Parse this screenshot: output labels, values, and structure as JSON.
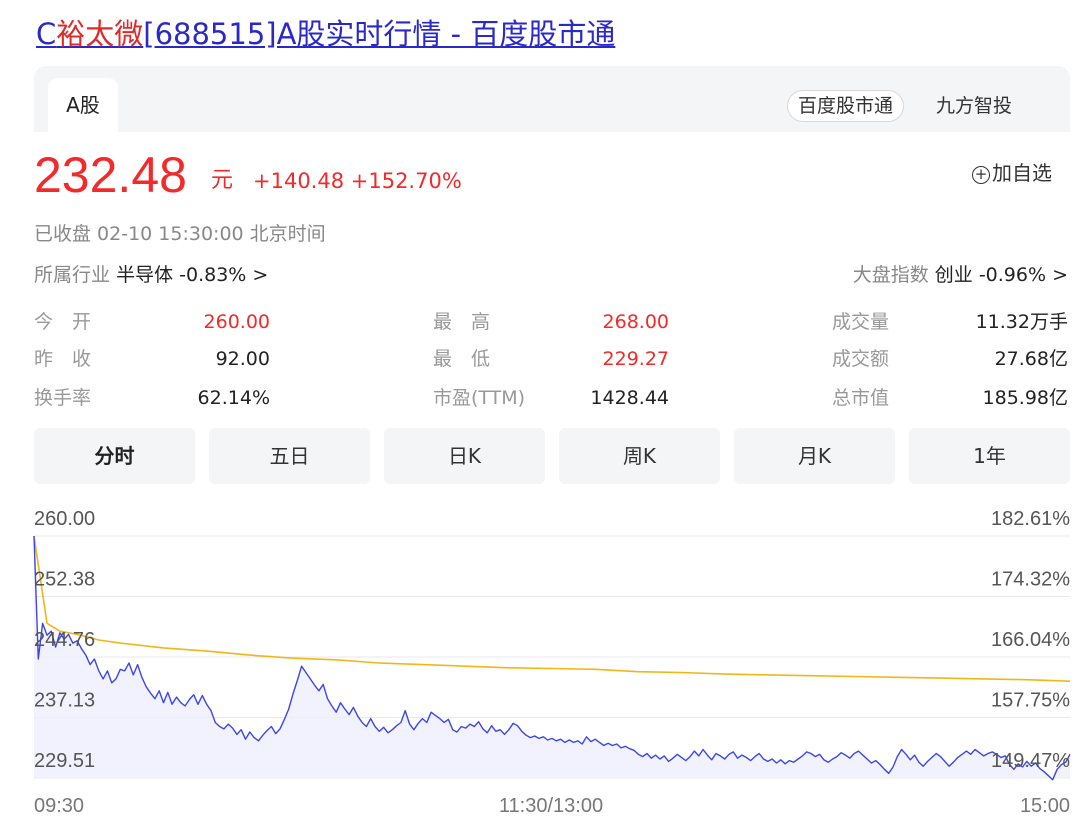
{
  "page_title": {
    "prefix": "C",
    "highlight": "裕太微",
    "suffix": "[688515]A股实时行情 - 百度股市通"
  },
  "tabs_top": {
    "a_share": "A股",
    "source_badge": "百度股市通",
    "partner": "九方智投"
  },
  "quote": {
    "price": "232.48",
    "unit": "元",
    "change": "+140.48 +152.70%",
    "watch_icon": "plus-circle-icon",
    "watch_label": "加自选",
    "status": "已收盘  02-10 15:30:00  北京时间"
  },
  "industry": {
    "label": "所属行业",
    "name": "半导体",
    "change": "-0.83%",
    "chevron": ">"
  },
  "market_index": {
    "label": "大盘指数",
    "name": "创业",
    "change": "-0.96%",
    "chevron": ">"
  },
  "stats": [
    {
      "label": "今　开",
      "value": "260.00",
      "color": "#f22a2a"
    },
    {
      "label": "最　高",
      "value": "268.00",
      "color": "#f22a2a"
    },
    {
      "label": "成交量",
      "value": "11.32万手",
      "color": "#222222"
    },
    {
      "label": "昨　收",
      "value": "92.00",
      "color": "#222222"
    },
    {
      "label": "最　低",
      "value": "229.27",
      "color": "#f22a2a"
    },
    {
      "label": "成交额",
      "value": "27.68亿",
      "color": "#222222"
    },
    {
      "label": "换手率",
      "value": "62.14%",
      "color": "#222222"
    },
    {
      "label": "市盈(TTM)",
      "value": "1428.44",
      "color": "#222222"
    },
    {
      "label": "总市值",
      "value": "185.98亿",
      "color": "#222222"
    }
  ],
  "period_tabs": [
    "分时",
    "五日",
    "日K",
    "周K",
    "月K",
    "1年"
  ],
  "active_period": "分时",
  "colors": {
    "up": "#f22a2a",
    "price_line": "#3d47e6",
    "avg_line": "#f2b619",
    "area_fill": "#eceefc",
    "link": "#2a28c9"
  },
  "chart_data": {
    "type": "line",
    "y_left_ticks": [
      "260.00",
      "252.38",
      "244.76",
      "237.13",
      "229.51"
    ],
    "y_right_ticks": [
      "182.61%",
      "174.32%",
      "166.04%",
      "157.75%",
      "149.47%"
    ],
    "x_ticks": [
      "09:30",
      "11:30/13:00",
      "15:00"
    ],
    "ylim": [
      229.51,
      260.0
    ],
    "x_range_minutes": [
      0,
      240
    ],
    "grid": true,
    "series": [
      {
        "values": [
          [
            0,
            260.0
          ],
          [
            1,
            244.5
          ],
          [
            2,
            249.0
          ],
          [
            3,
            247.5
          ],
          [
            4,
            248.0
          ],
          [
            5,
            246.0
          ],
          [
            6,
            247.8
          ],
          [
            7,
            247.0
          ],
          [
            8,
            247.6
          ],
          [
            9,
            246.5
          ],
          [
            10,
            246.8
          ],
          [
            11,
            245.8
          ],
          [
            12,
            245.0
          ],
          [
            13,
            243.8
          ],
          [
            14,
            244.5
          ],
          [
            15,
            243.0
          ],
          [
            16,
            242.0
          ],
          [
            17,
            243.0
          ],
          [
            18,
            241.5
          ],
          [
            19,
            242.0
          ],
          [
            20,
            243.2
          ],
          [
            21,
            243.0
          ],
          [
            22,
            244.0
          ],
          [
            23,
            242.5
          ],
          [
            24,
            243.8
          ],
          [
            25,
            242.2
          ],
          [
            26,
            241.0
          ],
          [
            27,
            240.2
          ],
          [
            28,
            239.5
          ],
          [
            29,
            240.5
          ],
          [
            30,
            239.0
          ],
          [
            31,
            240.3
          ],
          [
            32,
            238.8
          ],
          [
            33,
            239.7
          ],
          [
            34,
            239.0
          ],
          [
            35,
            238.6
          ],
          [
            36,
            239.4
          ],
          [
            37,
            240.0
          ],
          [
            38,
            238.8
          ],
          [
            39,
            239.9
          ],
          [
            40,
            238.8
          ],
          [
            41,
            238.0
          ],
          [
            42,
            236.5
          ],
          [
            43,
            236.0
          ],
          [
            44,
            235.7
          ],
          [
            45,
            236.3
          ],
          [
            46,
            235.8
          ],
          [
            47,
            235.0
          ],
          [
            48,
            235.6
          ],
          [
            49,
            234.4
          ],
          [
            50,
            235.3
          ],
          [
            51,
            234.6
          ],
          [
            52,
            234.2
          ],
          [
            53,
            234.9
          ],
          [
            54,
            235.5
          ],
          [
            55,
            236.0
          ],
          [
            56,
            235.1
          ],
          [
            57,
            235.7
          ],
          [
            58,
            236.9
          ],
          [
            59,
            238.2
          ],
          [
            60,
            240.1
          ],
          [
            61,
            241.8
          ],
          [
            62,
            243.6
          ],
          [
            63,
            242.8
          ],
          [
            64,
            242.0
          ],
          [
            65,
            241.2
          ],
          [
            66,
            240.5
          ],
          [
            67,
            241.3
          ],
          [
            68,
            239.5
          ],
          [
            69,
            238.6
          ],
          [
            70,
            237.8
          ],
          [
            71,
            239.0
          ],
          [
            72,
            238.2
          ],
          [
            73,
            237.5
          ],
          [
            74,
            238.4
          ],
          [
            75,
            237.3
          ],
          [
            76,
            236.5
          ],
          [
            77,
            236.0
          ],
          [
            78,
            237.0
          ],
          [
            79,
            236.0
          ],
          [
            80,
            235.4
          ],
          [
            81,
            235.9
          ],
          [
            82,
            235.2
          ],
          [
            83,
            235.6
          ],
          [
            84,
            236.1
          ],
          [
            85,
            236.5
          ],
          [
            86,
            238.0
          ],
          [
            87,
            236.3
          ],
          [
            88,
            235.6
          ],
          [
            89,
            236.4
          ],
          [
            90,
            237.0
          ],
          [
            91,
            236.5
          ],
          [
            92,
            237.8
          ],
          [
            93,
            237.4
          ],
          [
            94,
            237.0
          ],
          [
            95,
            236.5
          ],
          [
            96,
            236.9
          ],
          [
            97,
            235.6
          ],
          [
            98,
            235.3
          ],
          [
            99,
            236.0
          ],
          [
            100,
            235.8
          ],
          [
            101,
            236.3
          ],
          [
            102,
            236.0
          ],
          [
            103,
            236.6
          ],
          [
            104,
            235.7
          ],
          [
            105,
            235.2
          ],
          [
            106,
            236.1
          ],
          [
            107,
            235.4
          ],
          [
            108,
            235.6
          ],
          [
            109,
            235.0
          ],
          [
            110,
            235.6
          ],
          [
            111,
            236.4
          ],
          [
            112,
            236.1
          ],
          [
            113,
            235.4
          ],
          [
            114,
            234.9
          ],
          [
            115,
            234.6
          ],
          [
            116,
            234.8
          ],
          [
            117,
            234.5
          ],
          [
            118,
            234.7
          ],
          [
            119,
            234.3
          ],
          [
            120,
            234.5
          ],
          [
            121,
            234.2
          ],
          [
            122,
            234.4
          ],
          [
            123,
            234.0
          ],
          [
            124,
            234.3
          ],
          [
            125,
            234.0
          ],
          [
            126,
            234.2
          ],
          [
            127,
            233.8
          ],
          [
            128,
            234.7
          ],
          [
            129,
            234.1
          ],
          [
            130,
            234.4
          ],
          [
            131,
            234.0
          ],
          [
            132,
            233.6
          ],
          [
            133,
            233.9
          ],
          [
            134,
            233.6
          ],
          [
            135,
            233.8
          ],
          [
            136,
            233.3
          ],
          [
            137,
            233.5
          ],
          [
            138,
            233.2
          ],
          [
            139,
            233.0
          ],
          [
            140,
            232.5
          ],
          [
            141,
            232.2
          ],
          [
            142,
            232.6
          ],
          [
            143,
            232.0
          ],
          [
            144,
            232.4
          ],
          [
            145,
            231.9
          ],
          [
            146,
            232.3
          ],
          [
            147,
            231.6
          ],
          [
            148,
            232.0
          ],
          [
            149,
            232.5
          ],
          [
            150,
            232.1
          ],
          [
            151,
            231.7
          ],
          [
            152,
            232.2
          ],
          [
            153,
            232.9
          ],
          [
            154,
            232.3
          ],
          [
            155,
            233.1
          ],
          [
            156,
            232.4
          ],
          [
            157,
            231.8
          ],
          [
            158,
            232.6
          ],
          [
            159,
            232.3
          ],
          [
            160,
            231.9
          ],
          [
            161,
            232.5
          ],
          [
            162,
            232.8
          ],
          [
            163,
            232.0
          ],
          [
            164,
            232.4
          ],
          [
            165,
            232.1
          ],
          [
            166,
            231.7
          ],
          [
            167,
            232.2
          ],
          [
            168,
            232.6
          ],
          [
            169,
            231.9
          ],
          [
            170,
            231.6
          ],
          [
            171,
            231.9
          ],
          [
            172,
            231.4
          ],
          [
            173,
            231.8
          ],
          [
            174,
            231.3
          ],
          [
            175,
            231.7
          ],
          [
            176,
            231.5
          ],
          [
            177,
            231.9
          ],
          [
            178,
            232.3
          ],
          [
            179,
            232.8
          ],
          [
            180,
            232.6
          ],
          [
            181,
            232.2
          ],
          [
            182,
            232.5
          ],
          [
            183,
            231.8
          ],
          [
            184,
            231.5
          ],
          [
            185,
            231.9
          ],
          [
            186,
            232.2
          ],
          [
            187,
            232.7
          ],
          [
            188,
            232.4
          ],
          [
            189,
            232.0
          ],
          [
            190,
            232.6
          ],
          [
            191,
            232.9
          ],
          [
            192,
            232.4
          ],
          [
            193,
            231.9
          ],
          [
            194,
            231.4
          ],
          [
            195,
            231.7
          ],
          [
            196,
            231.2
          ],
          [
            197,
            230.6
          ],
          [
            198,
            230.1
          ],
          [
            199,
            230.9
          ],
          [
            200,
            232.2
          ],
          [
            201,
            233.1
          ],
          [
            202,
            232.5
          ],
          [
            203,
            231.8
          ],
          [
            204,
            232.4
          ],
          [
            205,
            231.5
          ],
          [
            206,
            231.0
          ],
          [
            207,
            231.6
          ],
          [
            208,
            232.1
          ],
          [
            209,
            232.6
          ],
          [
            210,
            232.2
          ],
          [
            211,
            231.6
          ],
          [
            212,
            231.0
          ],
          [
            213,
            231.5
          ],
          [
            214,
            232.1
          ],
          [
            215,
            232.5
          ],
          [
            216,
            232.9
          ],
          [
            217,
            232.5
          ],
          [
            218,
            233.1
          ],
          [
            219,
            232.7
          ],
          [
            220,
            232.3
          ],
          [
            221,
            232.6
          ],
          [
            222,
            232.8
          ],
          [
            223,
            232.5
          ],
          [
            224,
            232.1
          ],
          [
            225,
            232.3
          ],
          [
            226,
            231.2
          ],
          [
            227,
            230.6
          ],
          [
            228,
            231.3
          ],
          [
            229,
            230.9
          ],
          [
            230,
            231.6
          ],
          [
            231,
            231.0
          ],
          [
            232,
            231.4
          ],
          [
            233,
            230.7
          ],
          [
            234,
            230.3
          ],
          [
            235,
            229.8
          ],
          [
            236,
            229.3
          ],
          [
            237,
            230.6
          ],
          [
            238,
            231.2
          ],
          [
            239,
            231.5
          ],
          [
            240,
            232.48
          ]
        ]
      },
      {
        "values": [
          [
            0,
            260.0
          ],
          [
            3,
            249.0
          ],
          [
            6,
            248.0
          ],
          [
            10,
            247.6
          ],
          [
            15,
            246.9
          ],
          [
            20,
            246.5
          ],
          [
            30,
            245.9
          ],
          [
            40,
            245.5
          ],
          [
            50,
            245.0
          ],
          [
            60,
            244.6
          ],
          [
            70,
            244.4
          ],
          [
            80,
            244.0
          ],
          [
            90,
            243.8
          ],
          [
            100,
            243.6
          ],
          [
            110,
            243.4
          ],
          [
            120,
            243.3
          ],
          [
            130,
            243.2
          ],
          [
            140,
            242.9
          ],
          [
            150,
            242.8
          ],
          [
            160,
            242.6
          ],
          [
            170,
            242.5
          ],
          [
            180,
            242.4
          ],
          [
            190,
            242.3
          ],
          [
            200,
            242.2
          ],
          [
            210,
            242.1
          ],
          [
            220,
            242.0
          ],
          [
            230,
            241.9
          ],
          [
            240,
            241.7
          ]
        ]
      }
    ]
  }
}
